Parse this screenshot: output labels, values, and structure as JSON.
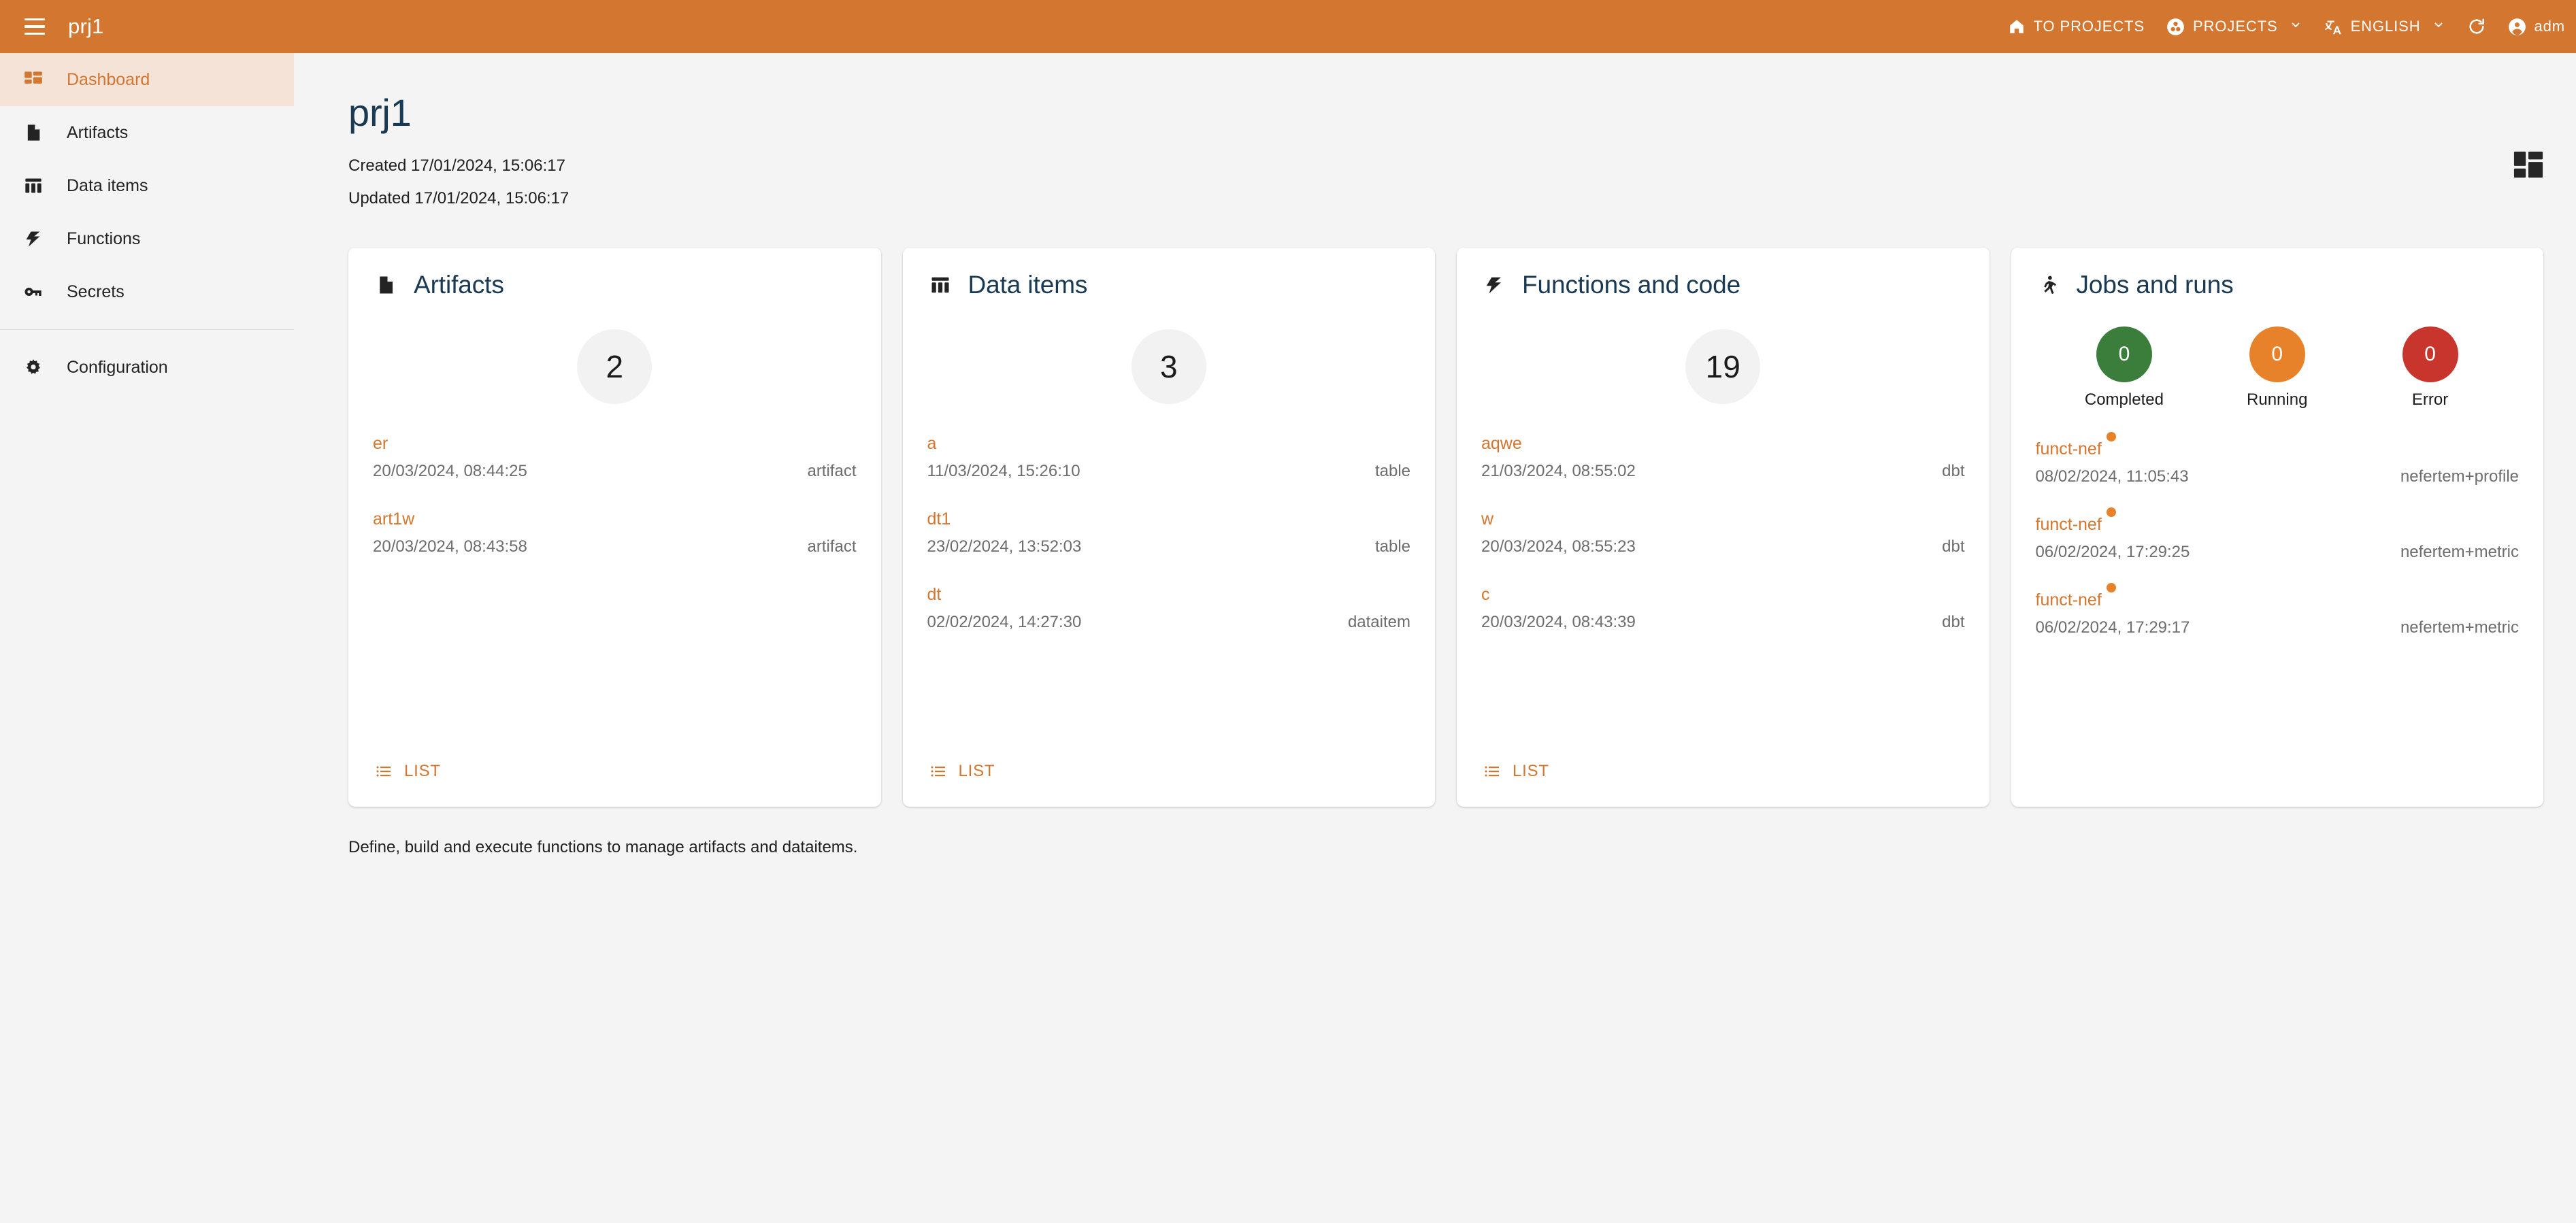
{
  "appbar": {
    "title": "prj1",
    "menu_icon": "hamburger-menu-icon",
    "items": [
      {
        "icon": "home-icon",
        "label": "TO PROJECTS",
        "chevron": ""
      },
      {
        "icon": "projects-icon",
        "label": "PROJECTS",
        "chevron": "⌄"
      },
      {
        "icon": "translate-icon",
        "label": "ENGLISH",
        "chevron": "⌄"
      },
      {
        "icon": "refresh-icon",
        "label": "",
        "chevron": ""
      },
      {
        "icon": "account-circle-icon",
        "label": "adm",
        "chevron": ""
      }
    ],
    "background_color": "#D3762F"
  },
  "sidebar": {
    "items": [
      {
        "label": "Dashboard",
        "icon": "dashboard-grid-icon",
        "active": true
      },
      {
        "label": "Artifacts",
        "icon": "document-icon",
        "active": false
      },
      {
        "label": "Data items",
        "icon": "table-columns-icon",
        "active": false
      },
      {
        "label": "Functions",
        "icon": "lightning-bolt-icon",
        "active": false
      },
      {
        "label": "Secrets",
        "icon": "key-icon",
        "active": false
      }
    ],
    "footer_items": [
      {
        "label": "Configuration",
        "icon": "gear-icon",
        "active": false
      }
    ],
    "active_bg_color": "#F5E3D8",
    "active_text_color": "#D3762F"
  },
  "page": {
    "title": "prj1",
    "created_label": "Created 17/01/2024, 15:06:17",
    "updated_label": "Updated 17/01/2024, 15:06:17",
    "grid_toggle_icon": "dashboard-layout-icon",
    "footer_note": "Define, build and execute functions to manage artifacts and dataitems."
  },
  "cards": [
    {
      "id": "artifacts",
      "title": "Artifacts",
      "icon": "document-icon",
      "count": "2",
      "rows": [
        {
          "name": "er",
          "date": "20/03/2024, 08:44:25",
          "kind": "artifact"
        },
        {
          "name": "art1w",
          "date": "20/03/2024, 08:43:58",
          "kind": "artifact"
        }
      ],
      "list_label": "LIST"
    },
    {
      "id": "data-items",
      "title": "Data items",
      "icon": "table-columns-icon",
      "count": "3",
      "rows": [
        {
          "name": "a",
          "date": "11/03/2024, 15:26:10",
          "kind": "table"
        },
        {
          "name": "dt1",
          "date": "23/02/2024, 13:52:03",
          "kind": "table"
        },
        {
          "name": "dt",
          "date": "02/02/2024, 14:27:30",
          "kind": "dataitem"
        }
      ],
      "list_label": "LIST"
    },
    {
      "id": "functions-and-code",
      "title": "Functions and code",
      "icon": "lightning-bolt-icon",
      "count": "19",
      "rows": [
        {
          "name": "aqwe",
          "date": "21/03/2024, 08:55:02",
          "kind": "dbt"
        },
        {
          "name": "w",
          "date": "20/03/2024, 08:55:23",
          "kind": "dbt"
        },
        {
          "name": "c",
          "date": "20/03/2024, 08:43:39",
          "kind": "dbt"
        }
      ],
      "list_label": "LIST"
    }
  ],
  "jobs_card": {
    "id": "jobs-and-runs",
    "title": "Jobs and runs",
    "icon": "running-person-icon",
    "statuses": [
      {
        "label": "Completed",
        "value": "0",
        "color": "#3B7D3A"
      },
      {
        "label": "Running",
        "value": "0",
        "color": "#E8822A"
      },
      {
        "label": "Error",
        "value": "0",
        "color": "#C8352C"
      }
    ],
    "rows": [
      {
        "name": "funct-nef",
        "date": "08/02/2024, 11:05:43",
        "kind": "nefertem+profile",
        "dot_color": "#E8822A"
      },
      {
        "name": "funct-nef",
        "date": "06/02/2024, 17:29:25",
        "kind": "nefertem+metric",
        "dot_color": "#E8822A"
      },
      {
        "name": "funct-nef",
        "date": "06/02/2024, 17:29:17",
        "kind": "nefertem+metric",
        "dot_color": "#E8822A"
      }
    ]
  }
}
